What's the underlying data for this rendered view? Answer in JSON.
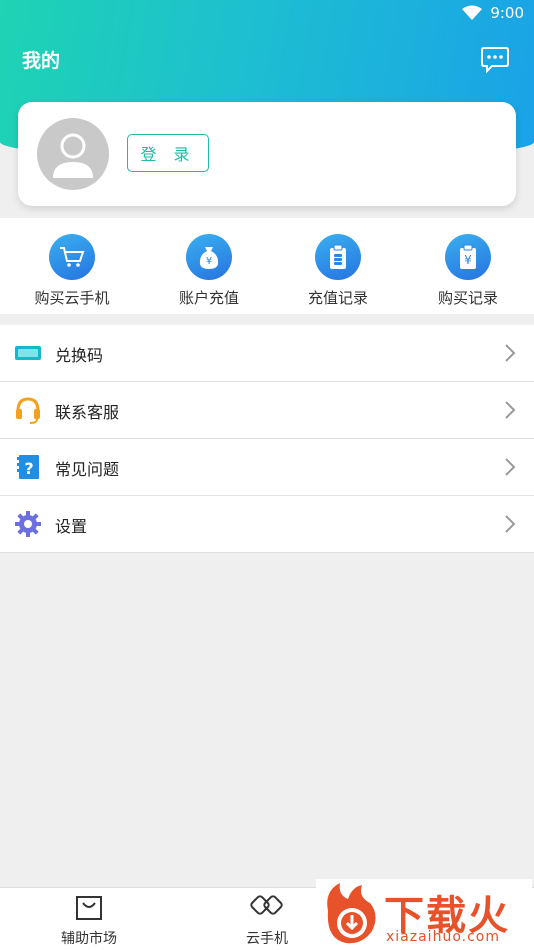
{
  "status_bar": {
    "time": "9:00",
    "wifi_icon": "wifi-icon"
  },
  "header": {
    "title": "我的",
    "message_icon": "chat-bubble-icon"
  },
  "profile": {
    "avatar_icon": "user-avatar-icon",
    "login_label": "登 录"
  },
  "quick_actions": [
    {
      "label": "购买云手机",
      "icon": "cart-icon"
    },
    {
      "label": "账户充值",
      "icon": "money-bag-icon"
    },
    {
      "label": "充值记录",
      "icon": "coin-clipboard-icon"
    },
    {
      "label": "购买记录",
      "icon": "yen-clipboard-icon"
    }
  ],
  "menu": [
    {
      "label": "兑换码",
      "icon": "ticket-icon"
    },
    {
      "label": "联系客服",
      "icon": "headset-icon"
    },
    {
      "label": "常见问题",
      "icon": "question-book-icon"
    },
    {
      "label": "设置",
      "icon": "gear-icon"
    }
  ],
  "bottom_nav": [
    {
      "label": "辅助市场",
      "icon": "bag-icon"
    },
    {
      "label": "云手机",
      "icon": "cloud-phone-icon"
    }
  ],
  "watermark": {
    "text": "下载火",
    "url": "xiazaihuo.com"
  },
  "colors": {
    "accent": "#22b9a6",
    "header_start": "#1fd3b3",
    "header_end": "#1aa2e8",
    "icon_blue": "#2a86e6",
    "watermark": "#e8522b"
  }
}
